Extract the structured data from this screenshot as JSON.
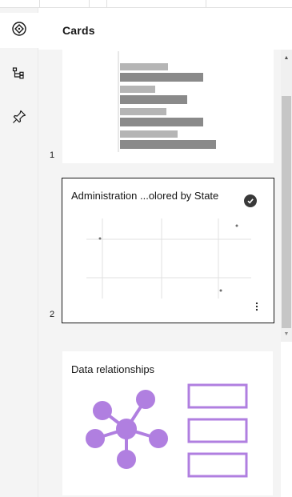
{
  "panel": {
    "title": "Cards"
  },
  "rail": {
    "items": [
      {
        "icon": "navigator-icon",
        "active": true
      },
      {
        "icon": "hierarchy-icon",
        "active": false
      },
      {
        "icon": "pin-icon",
        "active": false
      }
    ]
  },
  "cards": [
    {
      "number": "1",
      "title": "",
      "chart_type": "bar"
    },
    {
      "number": "2",
      "title": "Administration ...olored by State",
      "chart_type": "scatter",
      "selected": true
    },
    {
      "number": "",
      "title": "Data relationships",
      "chart_type": "relationships-illustration"
    }
  ],
  "colors": {
    "accent_purple": "#b07fe0",
    "bar_light": "#b5b5b5",
    "bar_dark": "#8a8a8a",
    "rail_bg": "#f4f4f4",
    "selected_border": "#161616"
  }
}
